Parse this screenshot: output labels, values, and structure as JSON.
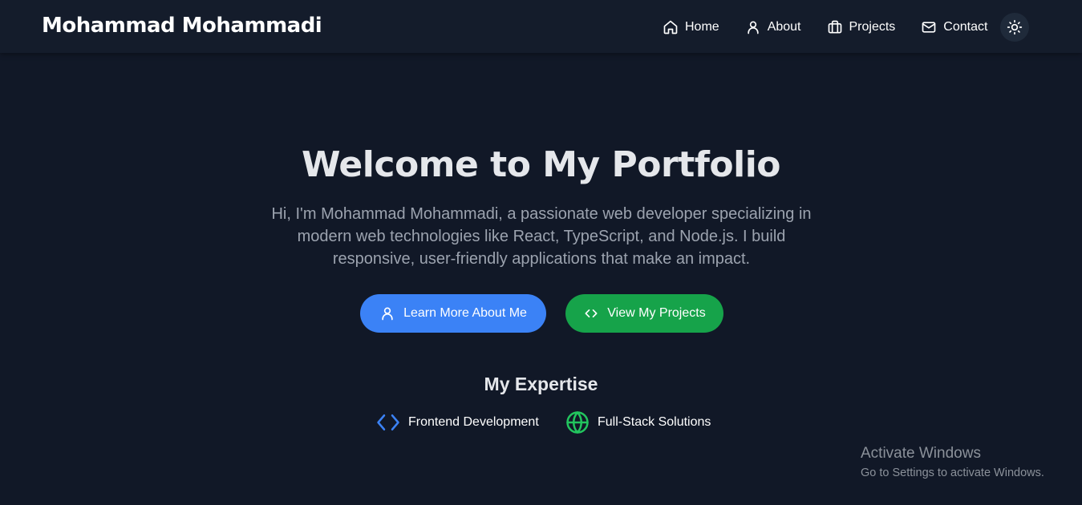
{
  "brand": "Mohammad Mohammadi",
  "nav": {
    "home": "Home",
    "about": "About",
    "projects": "Projects",
    "contact": "Contact"
  },
  "hero": {
    "title": "Welcome to My Portfolio",
    "description": "Hi, I'm Mohammad Mohammadi, a passionate web developer specializing in modern web technologies like React, TypeScript, and Node.js. I build responsive, user-friendly applications that make an impact.",
    "primary_button": "Learn More About Me",
    "secondary_button": "View My Projects"
  },
  "expertise": {
    "title": "My Expertise",
    "items": [
      {
        "label": "Frontend Development",
        "icon": "code-icon",
        "color": "#3b82f6"
      },
      {
        "label": "Full-Stack Solutions",
        "icon": "globe-icon",
        "color": "#22c55e"
      }
    ]
  },
  "watermark": {
    "title": "Activate Windows",
    "subtitle": "Go to Settings to activate Windows."
  },
  "colors": {
    "background": "#111827",
    "navbar": "#141c2b",
    "primary": "#3b82f6",
    "success": "#16a34a"
  }
}
